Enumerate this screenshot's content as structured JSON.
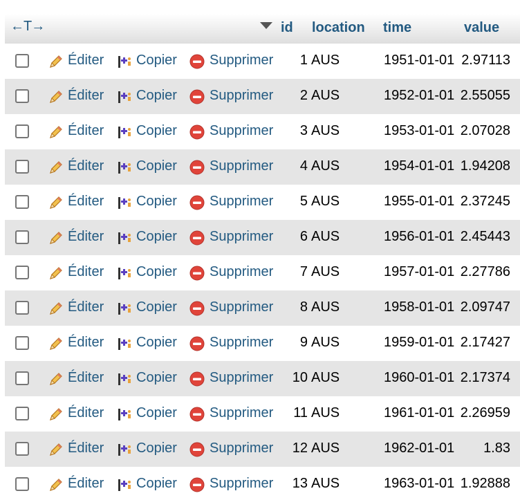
{
  "header": {
    "col_arrows": "←T→",
    "col_id": "id",
    "col_location": "location",
    "col_time": "time",
    "col_value": "value"
  },
  "actions": {
    "edit": "Éditer",
    "copy": "Copier",
    "delete": "Supprimer"
  },
  "colors": {
    "link": "#235a81",
    "row_alt": "#e5e5e5",
    "delete_icon": "#e0443a",
    "pencil": "#e8a33d",
    "copy_icon": "#5a3fc0"
  },
  "rows": [
    {
      "id": "1",
      "location": "AUS",
      "time": "1951-01-01",
      "value": "2.97113"
    },
    {
      "id": "2",
      "location": "AUS",
      "time": "1952-01-01",
      "value": "2.55055"
    },
    {
      "id": "3",
      "location": "AUS",
      "time": "1953-01-01",
      "value": "2.07028"
    },
    {
      "id": "4",
      "location": "AUS",
      "time": "1954-01-01",
      "value": "1.94208"
    },
    {
      "id": "5",
      "location": "AUS",
      "time": "1955-01-01",
      "value": "2.37245"
    },
    {
      "id": "6",
      "location": "AUS",
      "time": "1956-01-01",
      "value": "2.45443"
    },
    {
      "id": "7",
      "location": "AUS",
      "time": "1957-01-01",
      "value": "2.27786"
    },
    {
      "id": "8",
      "location": "AUS",
      "time": "1958-01-01",
      "value": "2.09747"
    },
    {
      "id": "9",
      "location": "AUS",
      "time": "1959-01-01",
      "value": "2.17427"
    },
    {
      "id": "10",
      "location": "AUS",
      "time": "1960-01-01",
      "value": "2.17374"
    },
    {
      "id": "11",
      "location": "AUS",
      "time": "1961-01-01",
      "value": "2.26959"
    },
    {
      "id": "12",
      "location": "AUS",
      "time": "1962-01-01",
      "value": "1.83"
    },
    {
      "id": "13",
      "location": "AUS",
      "time": "1963-01-01",
      "value": "1.92888"
    }
  ]
}
